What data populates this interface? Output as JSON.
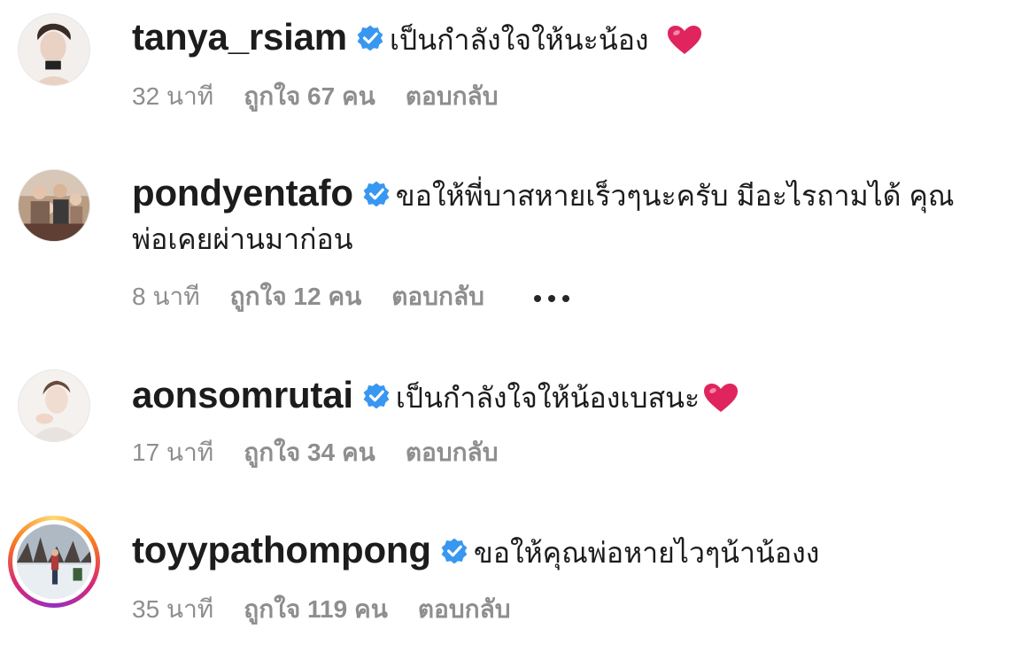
{
  "comments": [
    {
      "username": "tanya_rsiam",
      "verified": true,
      "text": "เป็นกำลังใจให้นะน้อง",
      "emoji": "heart",
      "time": "32 นาที",
      "likes": "ถูกใจ 67 คน",
      "reply": "ตอบกลับ"
    },
    {
      "username": "pondyentafo",
      "verified": true,
      "text": "ขอให้พี่บาสหายเร็วๆนะครับ มีอะไรถามได้ คุณ",
      "text_line2": "พ่อเคยผ่านมาก่อน",
      "time": "8 นาที",
      "likes": "ถูกใจ 12 คน",
      "reply": "ตอบกลับ",
      "more_icon": "ellipsis-icon"
    },
    {
      "username": "aonsomrutai",
      "verified": true,
      "text": "เป็นกำลังใจให้น้องเบสนะ",
      "emoji": "heart",
      "time": "17 นาที",
      "likes": "ถูกใจ 34 คน",
      "reply": "ตอบกลับ"
    },
    {
      "username": "toyypathompong",
      "verified": true,
      "has_story_ring": true,
      "text": "ขอให้คุณพ่อหายไวๆน้าน้องง",
      "time": "35 นาที",
      "likes": "ถูกใจ 119 คน",
      "reply": "ตอบกลับ"
    }
  ],
  "colors": {
    "verified_badge": "#3897f0",
    "heart": "#e0245e",
    "meta_text": "#8e8e8e",
    "story_ring": "#d62976"
  }
}
